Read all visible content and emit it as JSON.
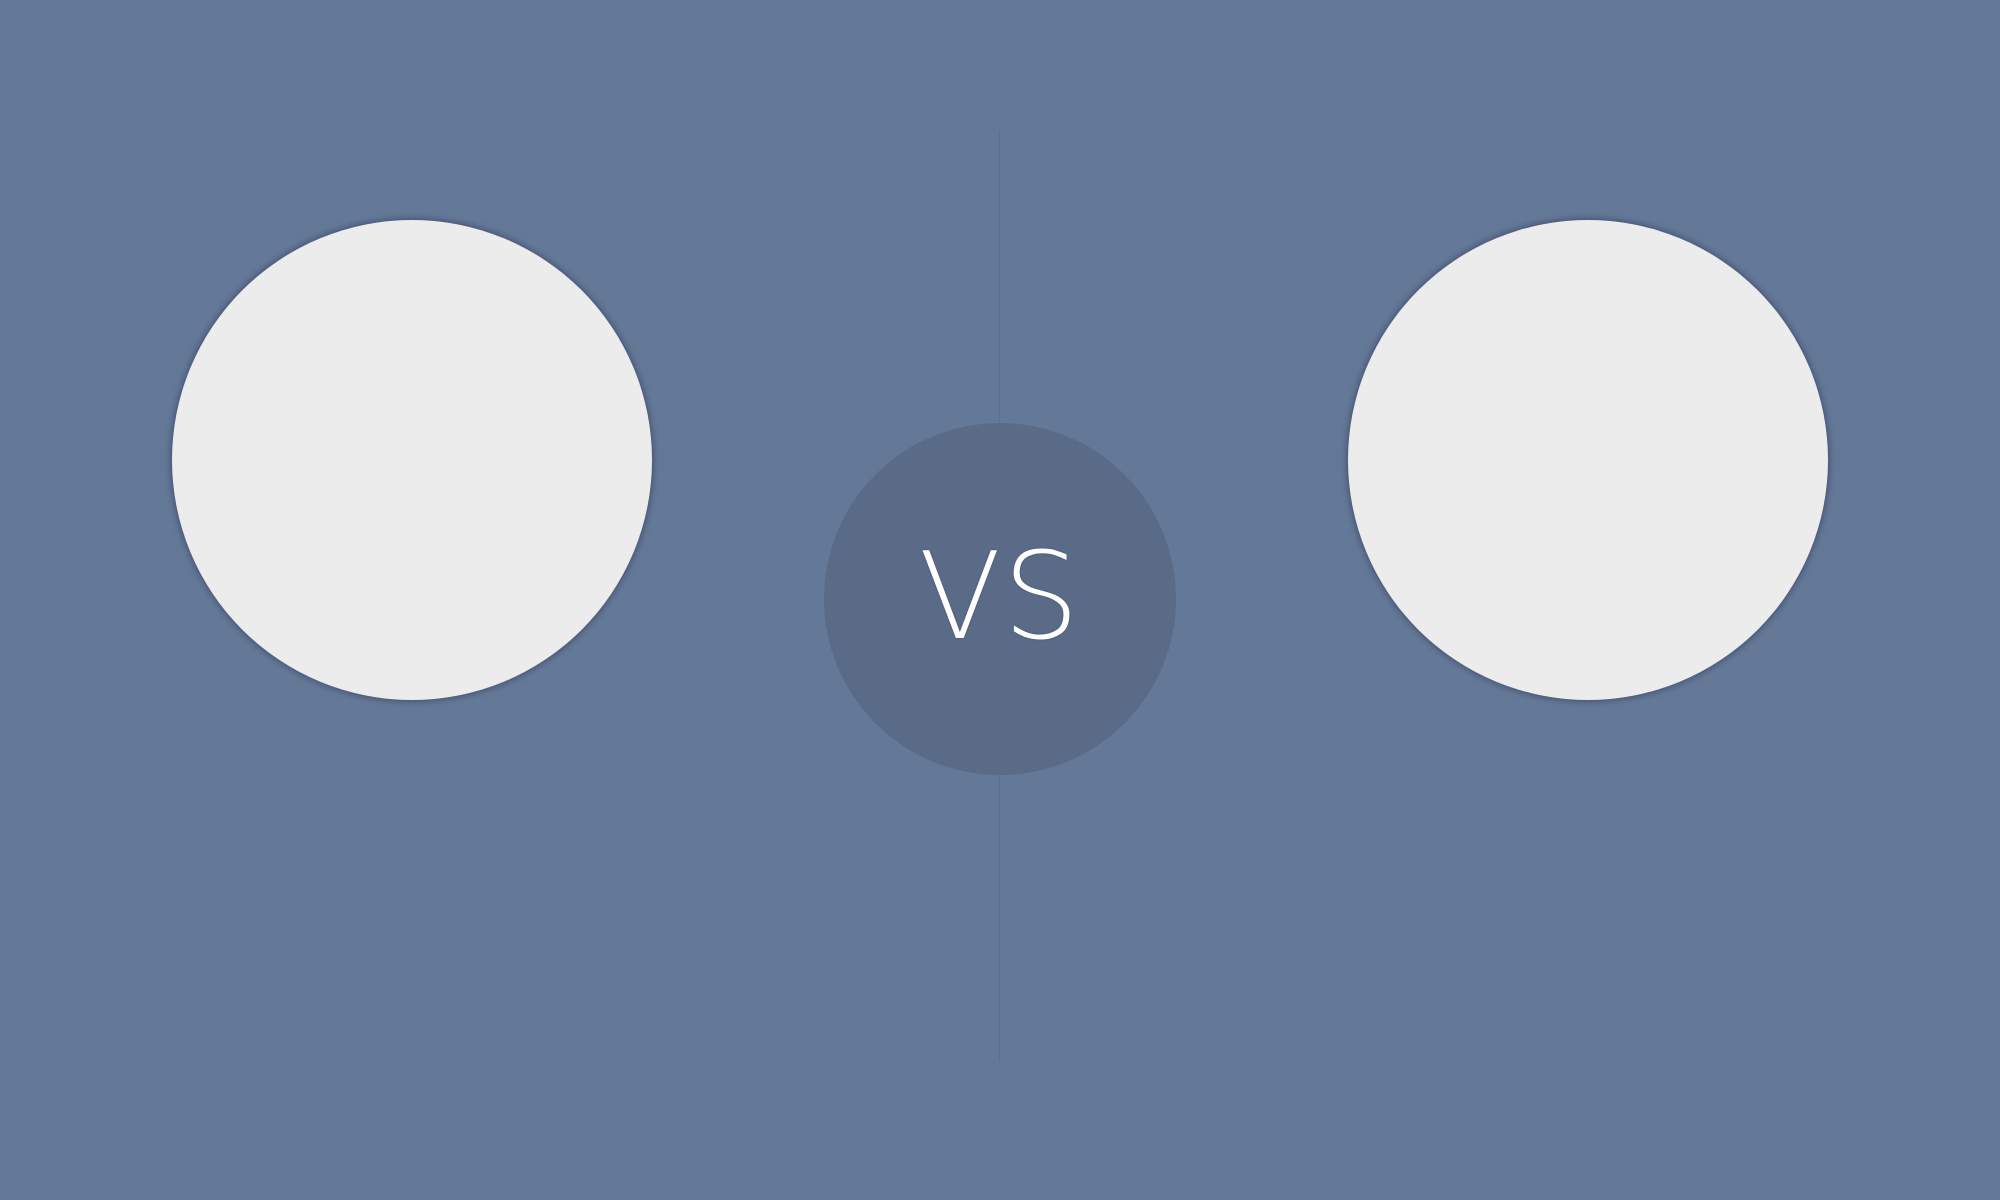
{
  "scene": {
    "background_color": "#647897",
    "badge_color": "#5a6b88",
    "avatar_color": "#ececec",
    "vs_label": "VS"
  }
}
